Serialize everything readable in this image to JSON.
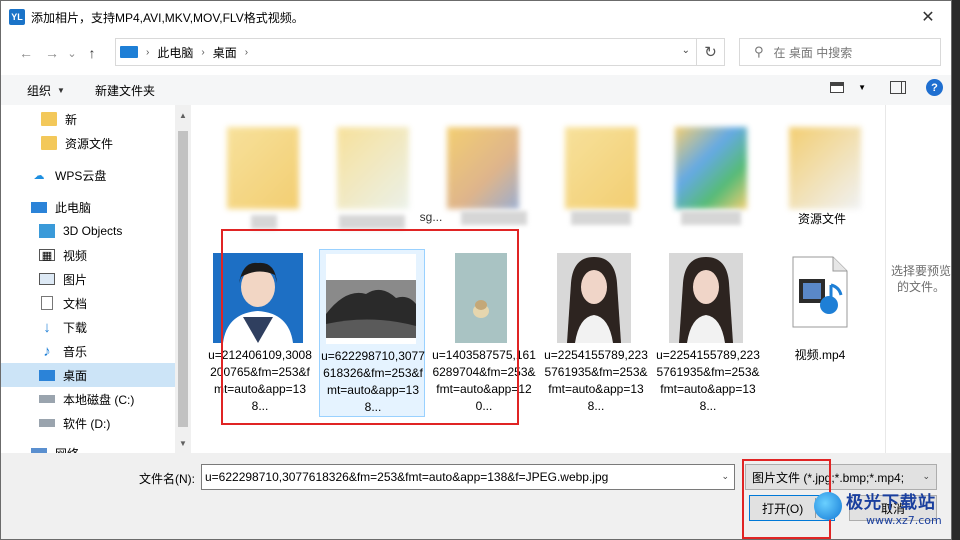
{
  "window": {
    "icon_text": "YL",
    "title": "添加相片，支持MP4,AVI,MKV,MOV,FLV格式视频。",
    "close_glyph": "✕"
  },
  "nav": {
    "back_glyph": "←",
    "forward_glyph": "→",
    "recent_glyph": "⌄",
    "up_glyph": "↑",
    "breadcrumb": [
      "此电脑",
      "桌面"
    ],
    "refresh_glyph": "↻",
    "search_placeholder": "在 桌面 中搜索"
  },
  "toolbar": {
    "organize": "组织",
    "new_folder": "新建文件夹"
  },
  "sidebar": {
    "items": [
      {
        "label": "新",
        "icon": "folder-icon"
      },
      {
        "label": "资源文件",
        "icon": "folder-icon"
      },
      {
        "label": "WPS云盘",
        "icon": "cloud-icon"
      },
      {
        "label": "此电脑",
        "icon": "computer-icon"
      },
      {
        "label": "3D Objects",
        "icon": "cube-icon"
      },
      {
        "label": "视频",
        "icon": "video-icon"
      },
      {
        "label": "图片",
        "icon": "picture-icon"
      },
      {
        "label": "文档",
        "icon": "document-icon"
      },
      {
        "label": "下载",
        "icon": "download-icon"
      },
      {
        "label": "音乐",
        "icon": "music-icon"
      },
      {
        "label": "桌面",
        "icon": "desktop-icon",
        "selected": true
      },
      {
        "label": "本地磁盘 (C:)",
        "icon": "drive-icon"
      },
      {
        "label": "软件 (D:)",
        "icon": "drive-icon"
      },
      {
        "label": "网络",
        "icon": "network-icon"
      }
    ]
  },
  "files": {
    "row1": [
      {
        "label": ""
      },
      {
        "label": ""
      },
      {
        "label": "sg..."
      },
      {
        "label": ""
      },
      {
        "label": ""
      },
      {
        "label": "资源文件"
      }
    ],
    "row2": [
      {
        "label": "u=212406109,3008200765&fm=253&fmt=auto&app=138..."
      },
      {
        "label": "u=622298710,3077618326&fm=253&fmt=auto&app=138..."
      },
      {
        "label": "u=1403587575,1616289704&fm=253&fmt=auto&app=120..."
      },
      {
        "label": "u=2254155789,2235761935&fm=253&fmt=auto&app=138..."
      },
      {
        "label": "u=2254155789,2235761935&fm=253&fmt=auto&app=138..."
      },
      {
        "label": "视频.mp4"
      }
    ]
  },
  "preview": {
    "text": "选择要预览的文件。"
  },
  "bottom": {
    "filename_label": "文件名(N):",
    "filename_value": "u=622298710,3077618326&fm=253&fmt=auto&app=138&f=JPEG.webp.jpg",
    "filetype_value": "图片文件 (*.jpg;*.bmp;*.mp4;",
    "open_label": "打开(O)",
    "cancel_label": "取消"
  },
  "watermark": {
    "title": "极光下载站",
    "url": "www.xz7.com"
  },
  "colors": {
    "accent": "#0078d7",
    "selection": "#cce4f7",
    "highlight_box": "#e02424"
  }
}
